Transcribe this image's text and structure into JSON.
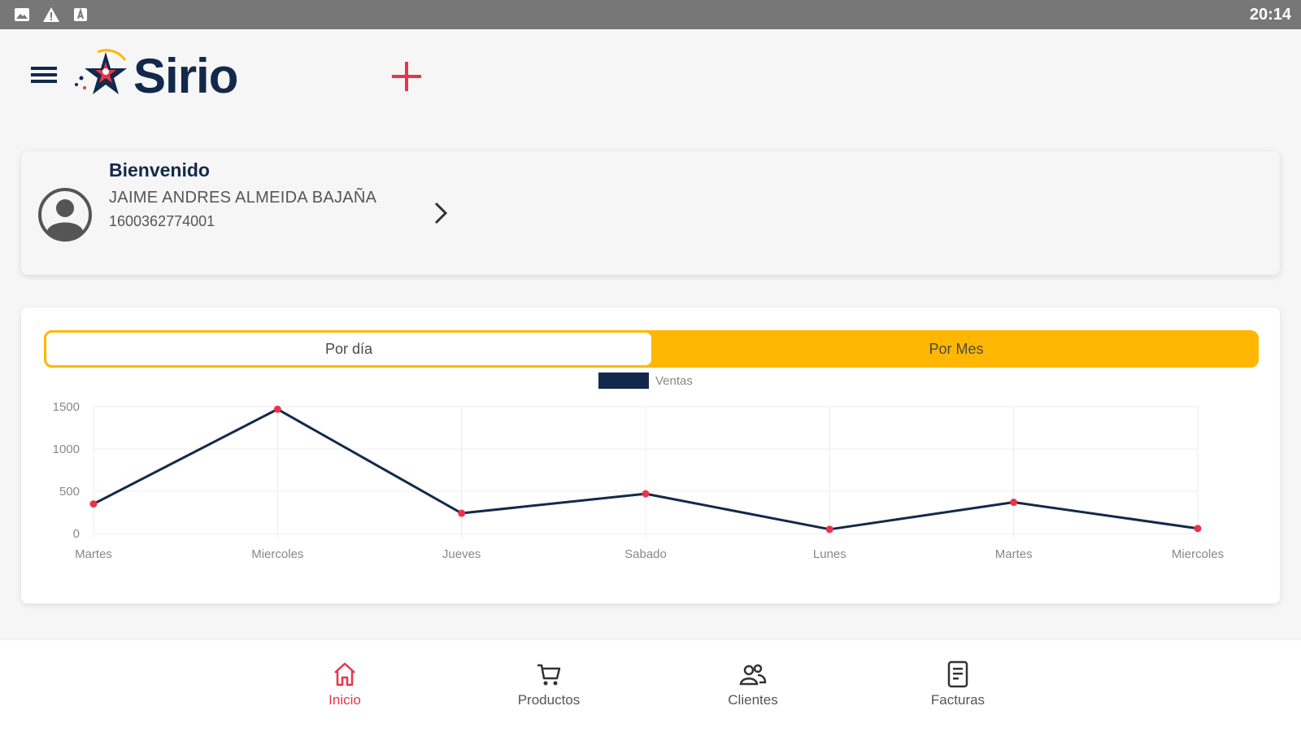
{
  "status_bar": {
    "time": "20:14",
    "icons": [
      "image-icon",
      "warning-icon",
      "a-badge-icon"
    ]
  },
  "app_bar": {
    "logo_text": "Sirio",
    "menu_icon": "hamburger-icon",
    "add_icon": "plus-icon",
    "accent_color": "#e8354a",
    "brand_color": "#13294b"
  },
  "welcome": {
    "title": "Bienvenido",
    "name": "JAIME ANDRES ALMEIDA BAJAÑA",
    "id": "1600362774001"
  },
  "tabs": {
    "day": "Por día",
    "month": "Por Mes",
    "active": "day",
    "color": "#ffb703"
  },
  "chart_data": {
    "type": "line",
    "categories": [
      "Martes",
      "Miercoles",
      "Jueves",
      "Sabado",
      "Lunes",
      "Martes",
      "Miercoles"
    ],
    "series": [
      {
        "name": "Ventas",
        "values": [
          350,
          1470,
          240,
          470,
          50,
          370,
          60
        ],
        "color": "#13294b",
        "point_color": "#e8354a"
      }
    ],
    "yticks": [
      0,
      500,
      1000,
      1500
    ],
    "ylim": [
      0,
      1500
    ],
    "legend": "top-center",
    "grid": true
  },
  "bottom_nav": {
    "items": [
      {
        "label": "Inicio",
        "icon": "home-icon",
        "active": true
      },
      {
        "label": "Productos",
        "icon": "cart-icon",
        "active": false
      },
      {
        "label": "Clientes",
        "icon": "users-icon",
        "active": false
      },
      {
        "label": "Facturas",
        "icon": "invoice-icon",
        "active": false
      }
    ]
  }
}
